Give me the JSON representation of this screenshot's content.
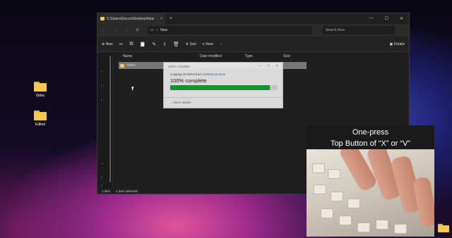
{
  "desktop": {
    "icons": [
      {
        "label": "Video"
      },
      {
        "label": "Edited"
      }
    ]
  },
  "explorer": {
    "tab_title": "C:\\Users\\Doccoi\\Desktop\\New",
    "close_glyph": "×",
    "newtab_glyph": "+",
    "window_controls": [
      "—",
      "☐",
      "✕"
    ],
    "address": {
      "back": "←",
      "forward": "→",
      "up": "↑",
      "refresh": "⟳",
      "monitor_icon": "▭",
      "sep": "›",
      "path": "New",
      "search_placeholder": "Search New"
    },
    "commandbar": {
      "new_label": "New",
      "new_glyph": "⊕",
      "sort_label": "Sort",
      "view_label": "View",
      "more_glyph": "···",
      "details_label": "Details",
      "icons": {
        "cut": "✂",
        "copy": "⧉",
        "paste": "📋",
        "rename": "✎",
        "share": "⇪",
        "delete": "🗑",
        "sort": "⇅",
        "view": "≡",
        "details": "▣"
      }
    },
    "columns": {
      "name": "Name",
      "date": "Date modified",
      "type": "Type",
      "size": "Size"
    },
    "rows": [
      {
        "name": "Video"
      }
    ],
    "status": {
      "items": "1 item",
      "selected": "1 item selected"
    }
  },
  "copy_dialog": {
    "title": "100% complete",
    "line_prefix": "Copying 10 items from ",
    "from": "Desktop",
    "to_word": " to ",
    "to": "New",
    "percent_text": "100% complete",
    "progress": 0.93,
    "more_details": "More details",
    "minimize": "—",
    "maximize": "☐",
    "close": "✕",
    "pause": "⏸",
    "cancel": "✕",
    "progress_color": "#0e9e2f"
  },
  "overlay": {
    "line1": "One-press",
    "line2": "Top Button of “X” or “V”"
  }
}
